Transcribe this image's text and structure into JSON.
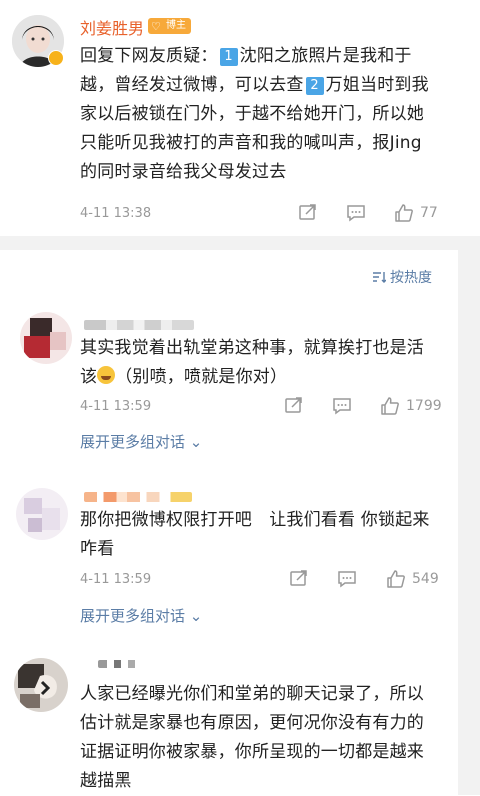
{
  "post": {
    "author": "刘姜胜男",
    "badge": "博主",
    "text_parts": [
      "回复下网友质疑：",
      "1",
      "沈阳之旅照片是我和于越，曾经发过微博，可以去查",
      "2",
      "万姐当时到我家以后被锁在门外，于越不给她开门，所以她只能听见我被打的声音和我的喊叫声，报Jing的同时录音给我父母发过去"
    ],
    "time": "4-11 13:38",
    "likes": "77"
  },
  "sort_label": "按热度",
  "comments": [
    {
      "text_before": "其实我觉着出轨堂弟这种事，就算挨打也是活该",
      "text_after": "（别喷，喷就是你对）",
      "time": "4-11 13:59",
      "likes": "1799",
      "expand": "展开更多组对话"
    },
    {
      "text": "那你把微博权限打开吧　让我们看看 你锁起来咋看",
      "time": "4-11 13:59",
      "likes": "549",
      "expand": "展开更多组对话"
    },
    {
      "text": "人家已经曝光你们和堂弟的聊天记录了，所以估计就是家暴也有原因，更何况你没有有力的证据证明你被家暴，你所呈现的一切都是越来越描黑"
    }
  ],
  "icons": {
    "share": "share-icon",
    "comment": "comment-icon",
    "like": "thumbs-up-icon",
    "sort": "sort-icon",
    "expand": "chevron-down-icon"
  },
  "colors": {
    "author": "#e8612b",
    "link": "#5b7da6",
    "badge": "#f7a93a",
    "number_badge": "#4aa5e6"
  }
}
